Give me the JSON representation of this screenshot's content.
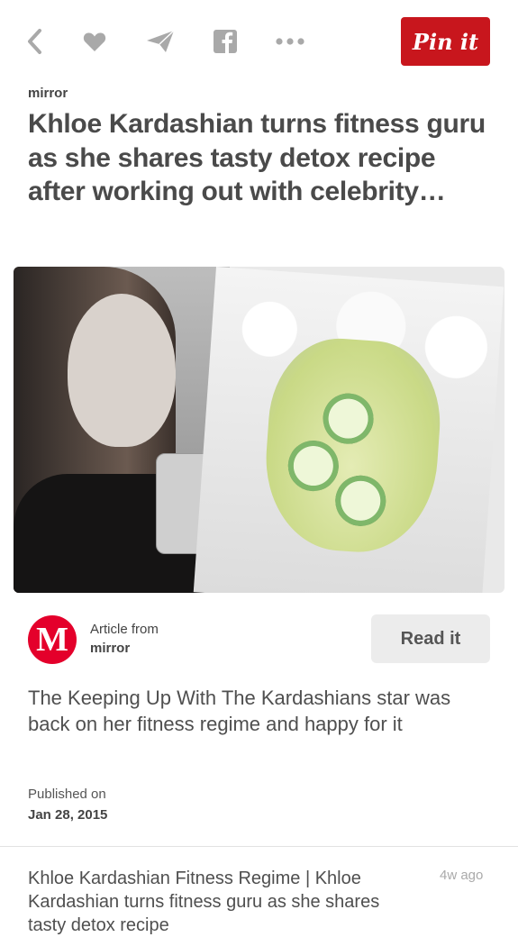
{
  "toolbar": {
    "icons": [
      "back-icon",
      "heart-icon",
      "send-icon",
      "facebook-icon",
      "more-icon"
    ],
    "pin_label": "Pin it"
  },
  "pin": {
    "source": "mirror",
    "headline": "Khloe Kardashian turns fitness guru as she shares tasty detox recipe after working out with celebrity…"
  },
  "article": {
    "logo_letter": "M",
    "from_label": "Article from",
    "source": "mirror",
    "read_label": "Read it",
    "description": "The Keeping Up With The Kardashians star was back on her fitness regime and happy for it",
    "published_label": "Published on",
    "published_date": "Jan 28, 2015"
  },
  "related": {
    "title": "Khloe Kardashian Fitness Regime | Khloe Kardashian turns fitness guru as she shares tasty detox recipe",
    "time": "4w ago"
  },
  "colors": {
    "pin_red": "#c8161d",
    "mirror_red": "#e4002b",
    "icon_gray": "#a9a9a9"
  }
}
